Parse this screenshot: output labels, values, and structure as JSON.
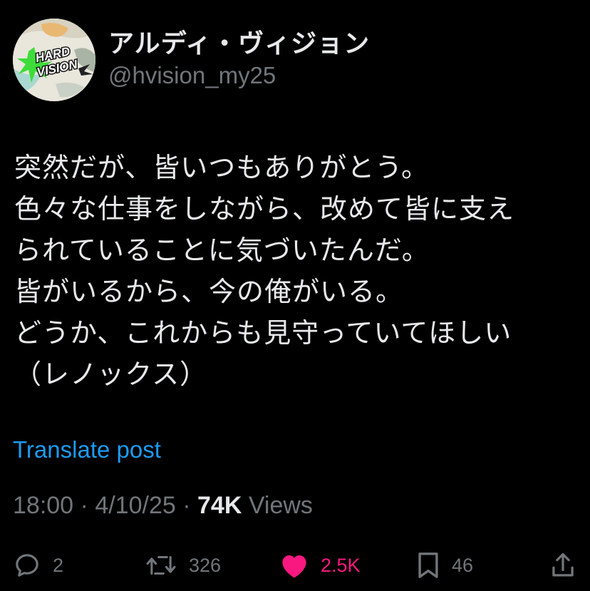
{
  "author": {
    "display_name": "アルディ・ヴィジョン",
    "handle": "@hvision_my25",
    "avatar_logo_text": "HARD VISION"
  },
  "post": {
    "lines": [
      "突然だが、皆いつもありがとう。",
      "色々な仕事をしながら、改めて皆に支え",
      "られていることに気づいたんだ。",
      "皆がいるから、今の俺がいる。",
      "どうか、これからも見守っていてほしい",
      "（レノックス）"
    ],
    "translate_label": "Translate post"
  },
  "meta": {
    "time": "18:00",
    "date": "4/10/25",
    "separator": "·",
    "views_count": "74K",
    "views_label": "Views"
  },
  "actions": {
    "reply": {
      "icon": "reply-icon",
      "count": "2"
    },
    "repost": {
      "icon": "repost-icon",
      "count": "326"
    },
    "like": {
      "icon": "heart-icon",
      "count": "2.5K",
      "active_color": "#f91880"
    },
    "bookmark": {
      "icon": "bookmark-icon",
      "count": "46"
    },
    "share": {
      "icon": "share-icon"
    }
  },
  "colors": {
    "background": "#000000",
    "text": "#e7e9ea",
    "secondary": "#71767b",
    "link": "#1d9bf0",
    "like": "#f91880"
  }
}
